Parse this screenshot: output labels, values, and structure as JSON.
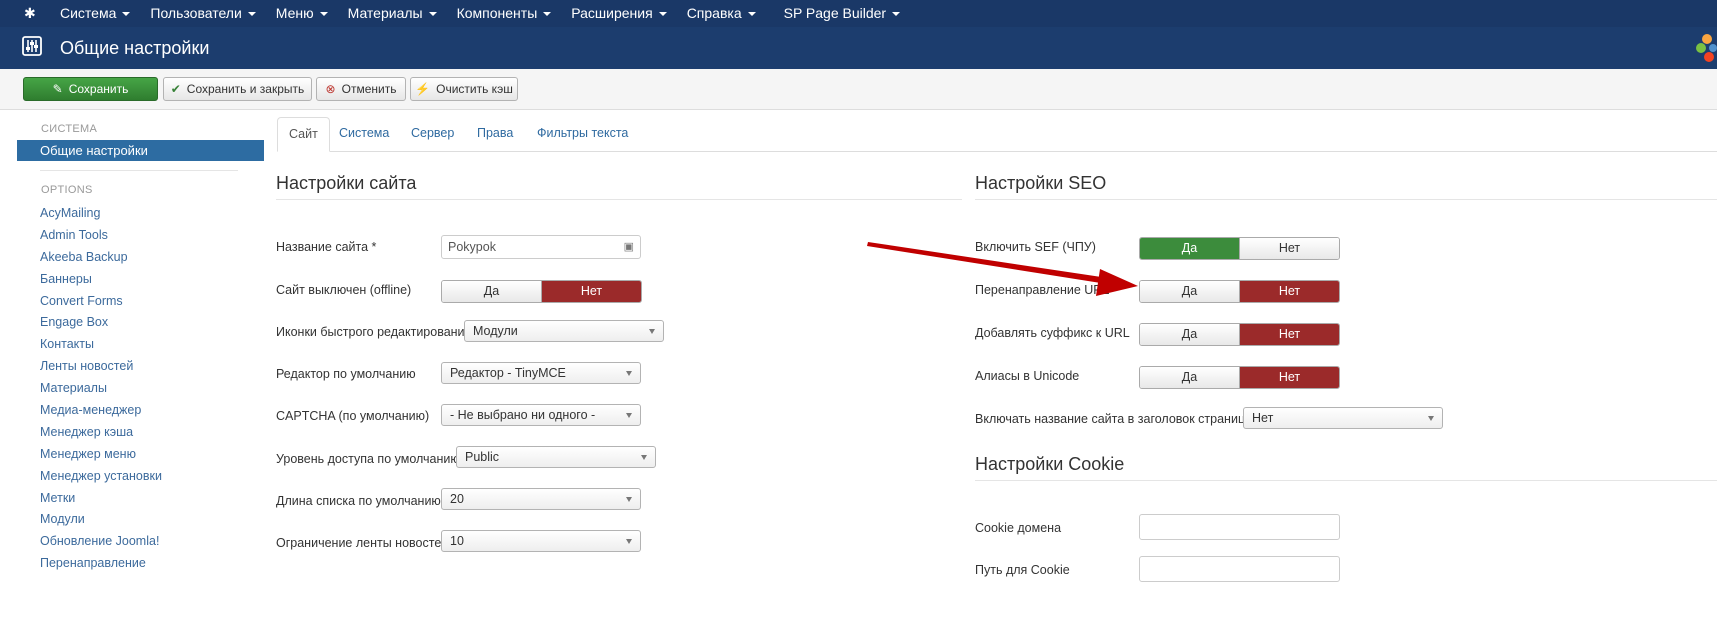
{
  "menu": [
    "Система",
    "Пользователи",
    "Меню",
    "Материалы",
    "Компоненты",
    "Расширения",
    "Справка",
    "SP Page Builder"
  ],
  "header": {
    "title": "Общие настройки"
  },
  "toolbar": {
    "save": "Сохранить",
    "save_close": "Сохранить и закрыть",
    "cancel": "Отменить",
    "clear_cache": "Очистить кэш"
  },
  "sidebar": {
    "system_heading": "СИСТЕМА",
    "active": "Общие настройки",
    "options_heading": "OPTIONS",
    "items": [
      "AcyMailing",
      "Admin Tools",
      "Akeeba Backup",
      "Баннеры",
      "Convert Forms",
      "Engage Box",
      "Контакты",
      "Ленты новостей",
      "Материалы",
      "Медиа-менеджер",
      "Менеджер кэша",
      "Менеджер меню",
      "Менеджер установки",
      "Метки",
      "Модули",
      "Обновление Joomla!",
      "Перенаправление"
    ]
  },
  "tabs": [
    "Сайт",
    "Система",
    "Сервер",
    "Права",
    "Фильтры текста"
  ],
  "site": {
    "title": "Настройки сайта",
    "name_label": "Название сайта *",
    "name_value": "Pokypok",
    "offline_label": "Сайт выключен (offline)",
    "offline_yes": "Да",
    "offline_no": "Нет",
    "quickedit_label": "Иконки быстрого редактирования",
    "quickedit_value": "Модули",
    "editor_label": "Редактор по умолчанию",
    "editor_value": "Редактор - TinyMCE",
    "captcha_label": "CAPTCHA (по умолчанию)",
    "captcha_value": "- Не выбрано ни одного -",
    "access_label": "Уровень доступа по умолчанию",
    "access_value": "Public",
    "listlen_label": "Длина списка по умолчанию",
    "listlen_value": "20",
    "feed_label": "Ограничение ленты новостей",
    "feed_value": "10"
  },
  "seo": {
    "title": "Настройки SEO",
    "sef_label": "Включить SEF (ЧПУ)",
    "redirect_label": "Перенаправление URL",
    "suffix_label": "Добавлять суффикс к URL",
    "unicode_label": "Алиасы в Unicode",
    "yes": "Да",
    "no": "Нет",
    "sitename_label": "Включать название сайта в заголовок страницы",
    "sitename_value": "Нет"
  },
  "cookie": {
    "title": "Настройки Cookie",
    "domain_label": "Cookie домена",
    "path_label": "Путь для Cookie"
  },
  "colors": {
    "topbar": "#1a3867",
    "header": "#1c3d6e",
    "active_red": "#9b2a2a",
    "active_green": "#3c8c3c",
    "arrow": "#c00000"
  }
}
